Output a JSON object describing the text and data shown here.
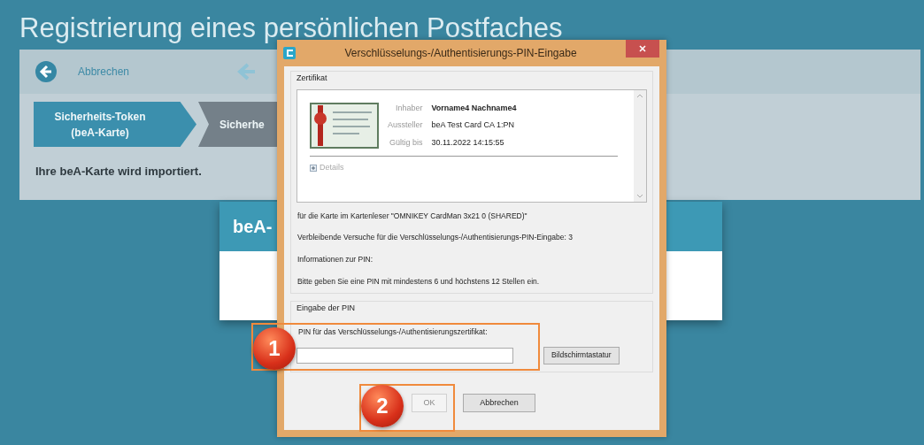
{
  "page_title": "Registrierung eines persönlichen Postfaches",
  "toolbar": {
    "cancel_link": "Abbrechen"
  },
  "steps": [
    {
      "label": "Sicherheits-Token (beA-Karte)",
      "selected": true
    },
    {
      "label": "Sicherhe",
      "selected": false
    }
  ],
  "status_text": "Ihre beA-Karte wird importiert.",
  "background_card": {
    "title": "beA-"
  },
  "dialog": {
    "title": "Verschlüsselungs-/Authentisierungs-PIN-Eingabe",
    "certificate_group": {
      "title": "Zertifikat",
      "fields": [
        {
          "label": "Inhaber",
          "value": "Vorname4 Nachname4",
          "bold": true
        },
        {
          "label": "Aussteller",
          "value": "beA Test Card CA 1:PN",
          "bold": false
        },
        {
          "label": "Gültig bis",
          "value": "30.11.2022 14:15:55",
          "bold": false
        }
      ],
      "details": "Details"
    },
    "info_lines": [
      "für die Karte im Kartenleser \"OMNIKEY CardMan 3x21 0 (SHARED)\"",
      "Verbleibende Versuche für die Verschlüsselungs-/Authentisierungs-PIN-Eingabe: 3",
      "Informationen zur PIN:",
      "Bitte geben Sie eine PIN mit mindestens 6 und höchstens 12 Stellen ein."
    ],
    "pin_group": {
      "title": "Eingabe der PIN",
      "label": "PIN für das Verschlüsselungs-/Authentisierungszertifikat:",
      "keyboard_button": "Bildschirmtastatur"
    },
    "buttons": [
      {
        "label": "OK",
        "disabled": true
      },
      {
        "label": "Abbrechen",
        "disabled": false
      }
    ]
  },
  "annotations": [
    {
      "label": "1"
    },
    {
      "label": "2"
    }
  ]
}
